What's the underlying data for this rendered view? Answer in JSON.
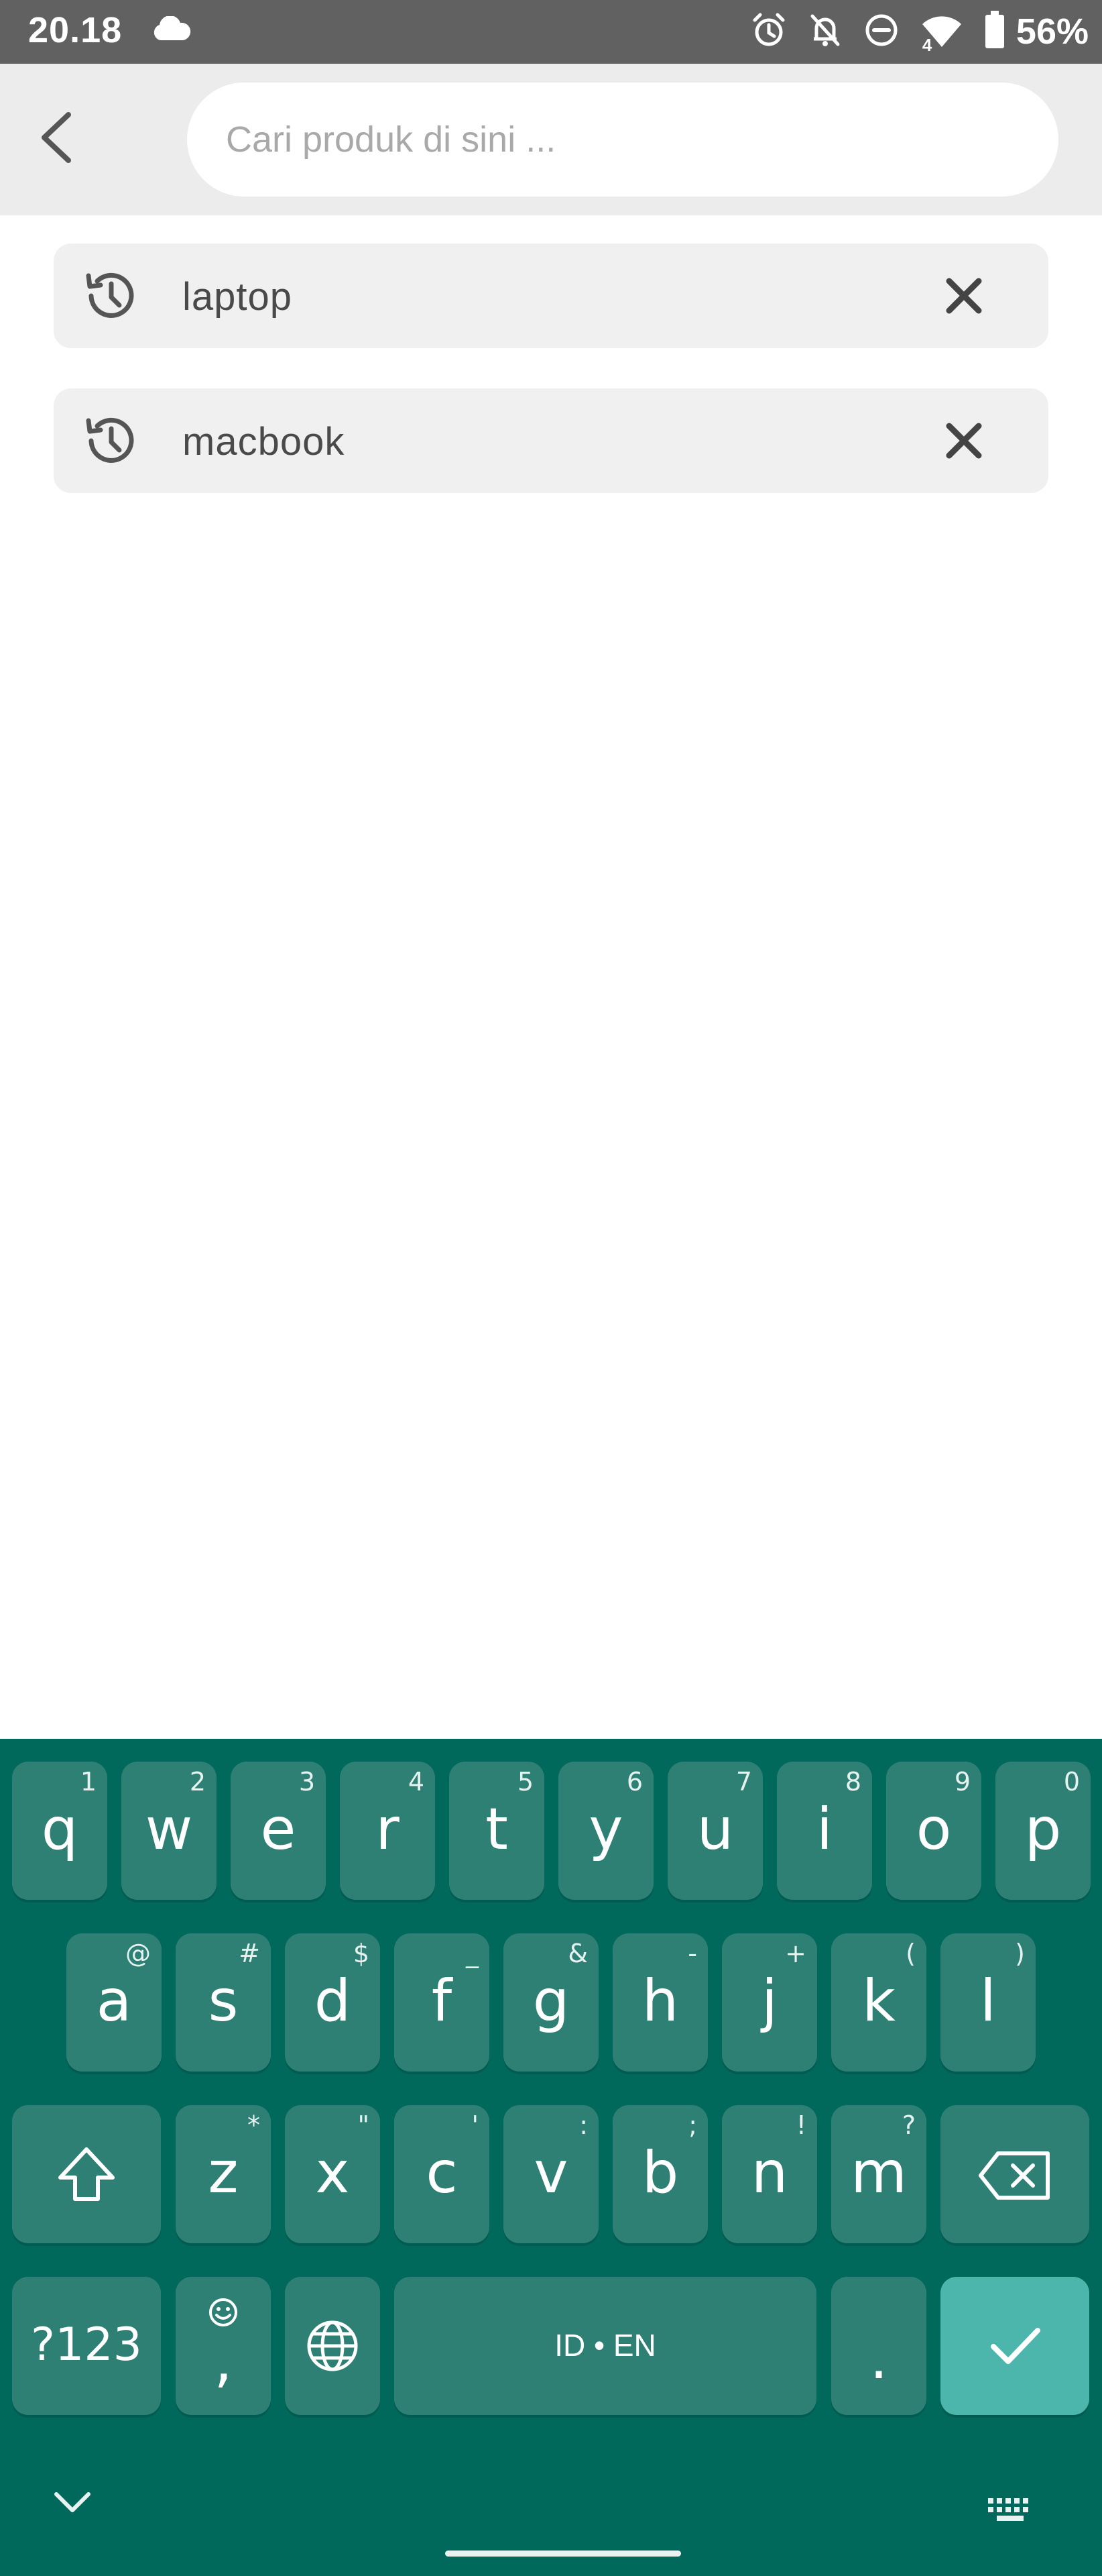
{
  "status_bar": {
    "time": "20.18",
    "network_badge": "4",
    "battery": "56%",
    "icons": [
      "cloud-icon",
      "alarm-icon",
      "notifications-off-icon",
      "do-not-disturb-icon",
      "wifi-icon",
      "battery-icon"
    ]
  },
  "header": {
    "back_icon": "chevron-left-icon",
    "search": {
      "placeholder": "Cari produk di sini ...",
      "value": ""
    }
  },
  "history": [
    {
      "label": "laptop",
      "icon": "history-icon",
      "remove_icon": "close-icon"
    },
    {
      "label": "macbook",
      "icon": "history-icon",
      "remove_icon": "close-icon"
    }
  ],
  "keyboard": {
    "row1": [
      {
        "main": "q",
        "hint": "1"
      },
      {
        "main": "w",
        "hint": "2"
      },
      {
        "main": "e",
        "hint": "3"
      },
      {
        "main": "r",
        "hint": "4"
      },
      {
        "main": "t",
        "hint": "5"
      },
      {
        "main": "y",
        "hint": "6"
      },
      {
        "main": "u",
        "hint": "7"
      },
      {
        "main": "i",
        "hint": "8"
      },
      {
        "main": "o",
        "hint": "9"
      },
      {
        "main": "p",
        "hint": "0"
      }
    ],
    "row2": [
      {
        "main": "a",
        "hint": "@"
      },
      {
        "main": "s",
        "hint": "#"
      },
      {
        "main": "d",
        "hint": "$"
      },
      {
        "main": "f",
        "hint": "_"
      },
      {
        "main": "g",
        "hint": "&"
      },
      {
        "main": "h",
        "hint": "-"
      },
      {
        "main": "j",
        "hint": "+"
      },
      {
        "main": "k",
        "hint": "("
      },
      {
        "main": "l",
        "hint": ")"
      }
    ],
    "row3": [
      {
        "main": "z",
        "hint": "*"
      },
      {
        "main": "x",
        "hint": "\""
      },
      {
        "main": "c",
        "hint": "'"
      },
      {
        "main": "v",
        "hint": ":"
      },
      {
        "main": "b",
        "hint": ";"
      },
      {
        "main": "n",
        "hint": "!"
      },
      {
        "main": "m",
        "hint": "?"
      }
    ],
    "symbols_label": "?123",
    "comma_label": ",",
    "space_label": "ID • EN",
    "period_label": ".",
    "colors": {
      "background": "#00695c",
      "key": "#2e8074",
      "enter": "#4db6ac"
    }
  }
}
